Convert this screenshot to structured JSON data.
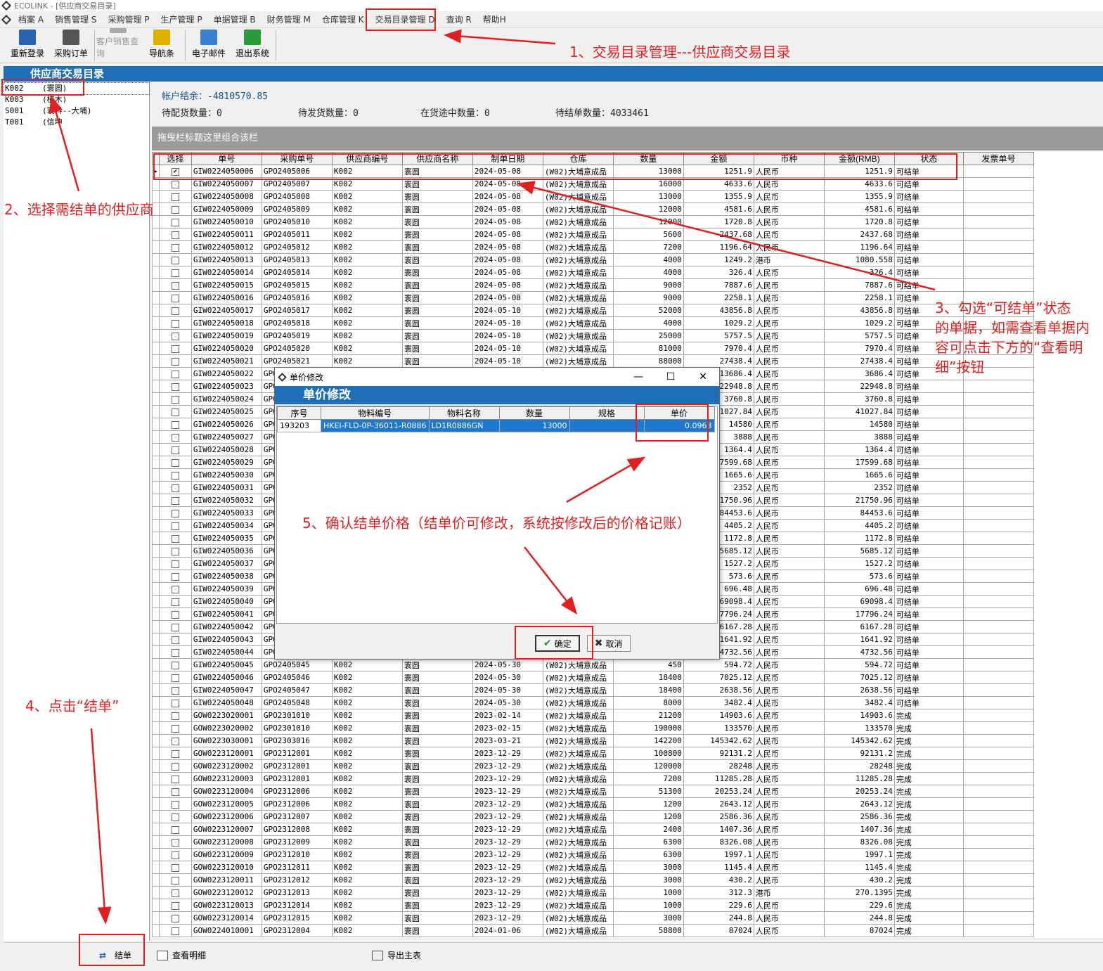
{
  "window": {
    "title": "ECOLINK - [供应商交易目录]"
  },
  "menu": [
    "档案 A",
    "销售管理 S",
    "采购管理 P",
    "生产管理 P",
    "单据管理 B",
    "财务管理 M",
    "仓库管理 K",
    "交易目录管理 D",
    "查询 R",
    "帮助H"
  ],
  "toolbar": [
    {
      "label": "重新登录",
      "icon": "relogin-icon",
      "enabled": true,
      "color": "#2a62b0"
    },
    {
      "label": "采购订单",
      "icon": "purchase-order-icon",
      "enabled": true,
      "color": "#555"
    },
    {
      "label": "客户销售查询",
      "icon": "customer-sales-icon",
      "enabled": false,
      "color": "#aaa"
    },
    {
      "label": "导航条",
      "icon": "navbar-icon",
      "enabled": true,
      "color": "#e0b000"
    },
    {
      "label": "电子邮件",
      "icon": "email-icon",
      "enabled": true,
      "color": "#3a7fd0"
    },
    {
      "label": "退出系统",
      "icon": "exit-icon",
      "enabled": true,
      "color": "#2a9a3a"
    }
  ],
  "page_title": "供应商交易目录",
  "suppliers": [
    {
      "code": "K002",
      "name": "(寰圆)",
      "selected": true
    },
    {
      "code": "K003",
      "name": "(植木)"
    },
    {
      "code": "S001",
      "name": "(寰料--大埔)"
    },
    {
      "code": "T001",
      "name": "(信坤"
    }
  ],
  "info": {
    "balance": "帐户结余：-4810570.85",
    "pending_alloc": "待配货数量：0",
    "pending_ship": "待发货数量：0",
    "in_transit": "在货途中数量：0",
    "pending_settle": "待结单数量：4033461"
  },
  "group_bar": "拖曳栏标题这里组合该栏",
  "columns": [
    "选择",
    "单号",
    "采购单号",
    "供应商编号",
    "供应商名称",
    "制单日期",
    "仓库",
    "数量",
    "金额",
    "币种",
    "金额(RMB)",
    "状态",
    "发票单号"
  ],
  "rows": [
    [
      "GIW0224050006",
      "GPO2405006",
      "K002",
      "寰圆",
      "2024-05-08",
      "(W02)大埔意成品",
      "13000",
      "1251.9",
      "人民币",
      "1251.9",
      "可结单"
    ],
    [
      "GIW0224050007",
      "GPO2405007",
      "K002",
      "寰圆",
      "2024-05-08",
      "(W02)大埔意成品",
      "16000",
      "4633.6",
      "人民币",
      "4633.6",
      "可结单"
    ],
    [
      "GIW0224050008",
      "GPO2405008",
      "K002",
      "寰圆",
      "2024-05-08",
      "(W02)大埔意成品",
      "13000",
      "1355.9",
      "人民币",
      "1355.9",
      "可结单"
    ],
    [
      "GIW0224050009",
      "GPO2405009",
      "K002",
      "寰圆",
      "2024-05-08",
      "(W02)大埔意成品",
      "12000",
      "4581.6",
      "人民币",
      "4581.6",
      "可结单"
    ],
    [
      "GIW0224050010",
      "GPO2405010",
      "K002",
      "寰圆",
      "2024-05-08",
      "(W02)大埔意成品",
      "12000",
      "1720.8",
      "人民币",
      "1720.8",
      "可结单"
    ],
    [
      "GIW0224050011",
      "GPO2405011",
      "K002",
      "寰圆",
      "2024-05-08",
      "(W02)大埔意成品",
      "5600",
      "2437.68",
      "人民币",
      "2437.68",
      "可结单"
    ],
    [
      "GIW0224050012",
      "GPO2405012",
      "K002",
      "寰圆",
      "2024-05-08",
      "(W02)大埔意成品",
      "7200",
      "1196.64",
      "人民币",
      "1196.64",
      "可结单"
    ],
    [
      "GIW0224050013",
      "GPO2405013",
      "K002",
      "寰圆",
      "2024-05-08",
      "(W02)大埔意成品",
      "4000",
      "1249.2",
      "港币",
      "1080.558",
      "可结单"
    ],
    [
      "GIW0224050014",
      "GPO2405014",
      "K002",
      "寰圆",
      "2024-05-08",
      "(W02)大埔意成品",
      "4000",
      "326.4",
      "人民币",
      "326.4",
      "可结单"
    ],
    [
      "GIW0224050015",
      "GPO2405015",
      "K002",
      "寰圆",
      "2024-05-08",
      "(W02)大埔意成品",
      "9000",
      "7887.6",
      "人民币",
      "7887.6",
      "可结单"
    ],
    [
      "GIW0224050016",
      "GPO2405016",
      "K002",
      "寰圆",
      "2024-05-08",
      "(W02)大埔意成品",
      "9000",
      "2258.1",
      "人民币",
      "2258.1",
      "可结单"
    ],
    [
      "GIW0224050017",
      "GPO2405017",
      "K002",
      "寰圆",
      "2024-05-10",
      "(W02)大埔意成品",
      "52000",
      "43856.8",
      "人民币",
      "43856.8",
      "可结单"
    ],
    [
      "GIW0224050018",
      "GPO2405018",
      "K002",
      "寰圆",
      "2024-05-10",
      "(W02)大埔意成品",
      "4000",
      "1029.2",
      "人民币",
      "1029.2",
      "可结单"
    ],
    [
      "GIW0224050019",
      "GPO2405019",
      "K002",
      "寰圆",
      "2024-05-10",
      "(W02)大埔意成品",
      "25000",
      "5757.5",
      "人民币",
      "5757.5",
      "可结单"
    ],
    [
      "GIW0224050020",
      "GPO2405020",
      "K002",
      "寰圆",
      "2024-05-10",
      "(W02)大埔意成品",
      "81000",
      "7970.4",
      "人民币",
      "7970.4",
      "可结单"
    ],
    [
      "GIW0224050021",
      "GPO2405021",
      "K002",
      "寰圆",
      "2024-05-10",
      "(W02)大埔意成品",
      "88000",
      "27438.4",
      "人民币",
      "27438.4",
      "可结单"
    ],
    [
      "GIW0224050022",
      "GPO",
      "",
      "",
      "",
      "",
      "",
      "13686.4",
      "人民币",
      "3686.4",
      "可结单"
    ],
    [
      "GIW0224050023",
      "GPO",
      "",
      "",
      "",
      "",
      "",
      "22948.8",
      "人民币",
      "22948.8",
      "可结单"
    ],
    [
      "GIW0224050024",
      "GPO",
      "",
      "",
      "",
      "",
      "",
      "3760.8",
      "人民币",
      "3760.8",
      "可结单"
    ],
    [
      "GIW0224050025",
      "GPO",
      "",
      "",
      "",
      "",
      "",
      "41027.84",
      "人民币",
      "41027.84",
      "可结单"
    ],
    [
      "GIW0224050026",
      "GPO",
      "",
      "",
      "",
      "",
      "",
      "14580",
      "人民币",
      "14580",
      "可结单"
    ],
    [
      "GIW0224050027",
      "GPO",
      "",
      "",
      "",
      "",
      "",
      "3888",
      "人民币",
      "3888",
      "可结单"
    ],
    [
      "GIW0224050028",
      "GPO",
      "",
      "",
      "",
      "",
      "",
      "1364.4",
      "人民币",
      "1364.4",
      "可结单"
    ],
    [
      "GIW0224050029",
      "GPO",
      "",
      "",
      "",
      "",
      "",
      "17599.68",
      "人民币",
      "17599.68",
      "可结单"
    ],
    [
      "GIW0224050030",
      "GPO",
      "",
      "",
      "",
      "",
      "",
      "1665.6",
      "人民币",
      "1665.6",
      "可结单"
    ],
    [
      "GIW0224050031",
      "GPO",
      "",
      "",
      "",
      "",
      "",
      "2352",
      "人民币",
      "2352",
      "可结单"
    ],
    [
      "GIW0224050032",
      "GPO",
      "",
      "",
      "",
      "",
      "",
      "21750.96",
      "人民币",
      "21750.96",
      "可结单"
    ],
    [
      "GIW0224050033",
      "GPO",
      "",
      "",
      "",
      "",
      "",
      "84453.6",
      "人民币",
      "84453.6",
      "可结单"
    ],
    [
      "GIW0224050034",
      "GPO",
      "",
      "",
      "",
      "",
      "",
      "4405.2",
      "人民币",
      "4405.2",
      "可结单"
    ],
    [
      "GIW0224050035",
      "GPO",
      "",
      "",
      "",
      "",
      "",
      "1172.8",
      "人民币",
      "1172.8",
      "可结单"
    ],
    [
      "GIW0224050036",
      "GPO",
      "",
      "",
      "",
      "",
      "",
      "5685.12",
      "人民币",
      "5685.12",
      "可结单"
    ],
    [
      "GIW0224050037",
      "GPO",
      "",
      "",
      "",
      "",
      "",
      "1527.2",
      "人民币",
      "1527.2",
      "可结单"
    ],
    [
      "GIW0224050038",
      "GPO",
      "",
      "",
      "",
      "",
      "",
      "573.6",
      "人民币",
      "573.6",
      "可结单"
    ],
    [
      "GIW0224050039",
      "GPO",
      "",
      "",
      "",
      "",
      "",
      "696.48",
      "人民币",
      "696.48",
      "可结单"
    ],
    [
      "GIW0224050040",
      "GPO",
      "",
      "",
      "",
      "",
      "",
      "69098.4",
      "人民币",
      "69098.4",
      "可结单"
    ],
    [
      "GIW0224050041",
      "GPO",
      "",
      "",
      "",
      "",
      "",
      "17796.24",
      "人民币",
      "17796.24",
      "可结单"
    ],
    [
      "GIW0224050042",
      "GPO",
      "",
      "",
      "",
      "",
      "",
      "6167.28",
      "人民币",
      "6167.28",
      "可结单"
    ],
    [
      "GIW0224050043",
      "GPO",
      "",
      "",
      "",
      "",
      "",
      "1641.92",
      "人民币",
      "1641.92",
      "可结单"
    ],
    [
      "GIW0224050044",
      "GPO",
      "",
      "",
      "",
      "",
      "",
      "4732.56",
      "人民币",
      "4732.56",
      "可结单"
    ],
    [
      "GIW0224050045",
      "GPO2405045",
      "K002",
      "寰圆",
      "2024-05-30",
      "(W02)大埔意成品",
      "450",
      "594.72",
      "人民币",
      "594.72",
      "可结单"
    ],
    [
      "GIW0224050046",
      "GPO2405046",
      "K002",
      "寰圆",
      "2024-05-30",
      "(W02)大埔意成品",
      "18400",
      "7025.12",
      "人民币",
      "7025.12",
      "可结单"
    ],
    [
      "GIW0224050047",
      "GPO2405047",
      "K002",
      "寰圆",
      "2024-05-30",
      "(W02)大埔意成品",
      "18400",
      "2638.56",
      "人民币",
      "2638.56",
      "可结单"
    ],
    [
      "GIW0224050048",
      "GPO2405048",
      "K002",
      "寰圆",
      "2024-05-30",
      "(W02)大埔意成品",
      "8000",
      "3482.4",
      "人民币",
      "3482.4",
      "可结单"
    ],
    [
      "GOW0223020001",
      "GPO2301010",
      "K002",
      "寰圆",
      "2023-02-14",
      "(W02)大埔意成品",
      "21200",
      "14903.6",
      "人民币",
      "14903.6",
      "完成"
    ],
    [
      "GOW0223020002",
      "GPO2301010",
      "K002",
      "寰圆",
      "2023-02-15",
      "(W02)大埔意成品",
      "190000",
      "133570",
      "人民币",
      "133570",
      "完成"
    ],
    [
      "GOW0223030001",
      "GPO2303016",
      "K002",
      "寰圆",
      "2023-03-21",
      "(W02)大埔意成品",
      "142200",
      "145342.62",
      "人民币",
      "145342.62",
      "完成"
    ],
    [
      "GOW0223120001",
      "GPO2312001",
      "K002",
      "寰圆",
      "2023-12-29",
      "(W02)大埔意成品",
      "100800",
      "92131.2",
      "人民币",
      "92131.2",
      "完成"
    ],
    [
      "GOW0223120002",
      "GPO2312001",
      "K002",
      "寰圆",
      "2023-12-29",
      "(W02)大埔意成品",
      "120000",
      "28248",
      "人民币",
      "28248",
      "完成"
    ],
    [
      "GOW0223120003",
      "GPO2312001",
      "K002",
      "寰圆",
      "2023-12-29",
      "(W02)大埔意成品",
      "7200",
      "11285.28",
      "人民币",
      "11285.28",
      "完成"
    ],
    [
      "GOW0223120004",
      "GPO2312006",
      "K002",
      "寰圆",
      "2023-12-29",
      "(W02)大埔意成品",
      "51300",
      "20253.24",
      "人民币",
      "20253.24",
      "完成"
    ],
    [
      "GOW0223120005",
      "GPO2312006",
      "K002",
      "寰圆",
      "2023-12-29",
      "(W02)大埔意成品",
      "1200",
      "2643.12",
      "人民币",
      "2643.12",
      "完成"
    ],
    [
      "GOW0223120006",
      "GPO2312007",
      "K002",
      "寰圆",
      "2023-12-29",
      "(W02)大埔意成品",
      "1200",
      "2586.36",
      "人民币",
      "2586.36",
      "完成"
    ],
    [
      "GOW0223120007",
      "GPO2312008",
      "K002",
      "寰圆",
      "2023-12-29",
      "(W02)大埔意成品",
      "2400",
      "1407.36",
      "人民币",
      "1407.36",
      "完成"
    ],
    [
      "GOW0223120008",
      "GPO2312009",
      "K002",
      "寰圆",
      "2023-12-29",
      "(W02)大埔意成品",
      "6300",
      "8326.08",
      "人民币",
      "8326.08",
      "完成"
    ],
    [
      "GOW0223120009",
      "GPO2312010",
      "K002",
      "寰圆",
      "2023-12-29",
      "(W02)大埔意成品",
      "6300",
      "1997.1",
      "人民币",
      "1997.1",
      "完成"
    ],
    [
      "GOW0223120010",
      "GPO2312011",
      "K002",
      "寰圆",
      "2023-12-29",
      "(W02)大埔意成品",
      "3000",
      "1145.4",
      "人民币",
      "1145.4",
      "完成"
    ],
    [
      "GOW0223120011",
      "GPO2312012",
      "K002",
      "寰圆",
      "2023-12-29",
      "(W02)大埔意成品",
      "3000",
      "430.2",
      "人民币",
      "430.2",
      "完成"
    ],
    [
      "GOW0223120012",
      "GPO2312013",
      "K002",
      "寰圆",
      "2023-12-29",
      "(W02)大埔意成品",
      "1000",
      "312.3",
      "港币",
      "270.1395",
      "完成"
    ],
    [
      "GOW0223120013",
      "GPO2312014",
      "K002",
      "寰圆",
      "2023-12-29",
      "(W02)大埔意成品",
      "1000",
      "229.6",
      "人民币",
      "229.6",
      "完成"
    ],
    [
      "GOW0223120014",
      "GPO2312015",
      "K002",
      "寰圆",
      "2023-12-29",
      "(W02)大埔意成品",
      "3000",
      "244.8",
      "人民币",
      "244.8",
      "完成"
    ],
    [
      "GOW0224010001",
      "GPO2312004",
      "K002",
      "寰圆",
      "2024-01-06",
      "(W02)大埔意成品",
      "58800",
      "87024",
      "人民币",
      "87024",
      "完成"
    ]
  ],
  "bottom_buttons": [
    {
      "label": "结单",
      "icon": "settle-icon"
    },
    {
      "label": "查看明细",
      "icon": "view-detail-icon"
    },
    {
      "label": "导出主表",
      "icon": "export-icon"
    }
  ],
  "dialog": {
    "title": "单价修改",
    "header": "单价修改",
    "columns": [
      "序号",
      "物料编号",
      "物料名称",
      "数量",
      "规格",
      "单价"
    ],
    "row": [
      "193203",
      "HKEI-FLD-0P-36011-R0886",
      "LD1R0886GN",
      "13000",
      "",
      "0.0963"
    ],
    "ok": "确定",
    "cancel": "取消"
  },
  "annotations": {
    "a1": "1、交易目录管理---供应商交易目录",
    "a2": "2、选择需结单的供应商",
    "a3": "3、勾选“可结单”状态\n的单据，如需查看单据内\n容可点击下方的“查看明\n细”按钮",
    "a4": "4、点击“结单”",
    "a5": "5、确认结单价格（结单价可修改，系统按修改后的价格记账）"
  },
  "accent": "#1e6fb8",
  "annotation_color": "#e02020"
}
